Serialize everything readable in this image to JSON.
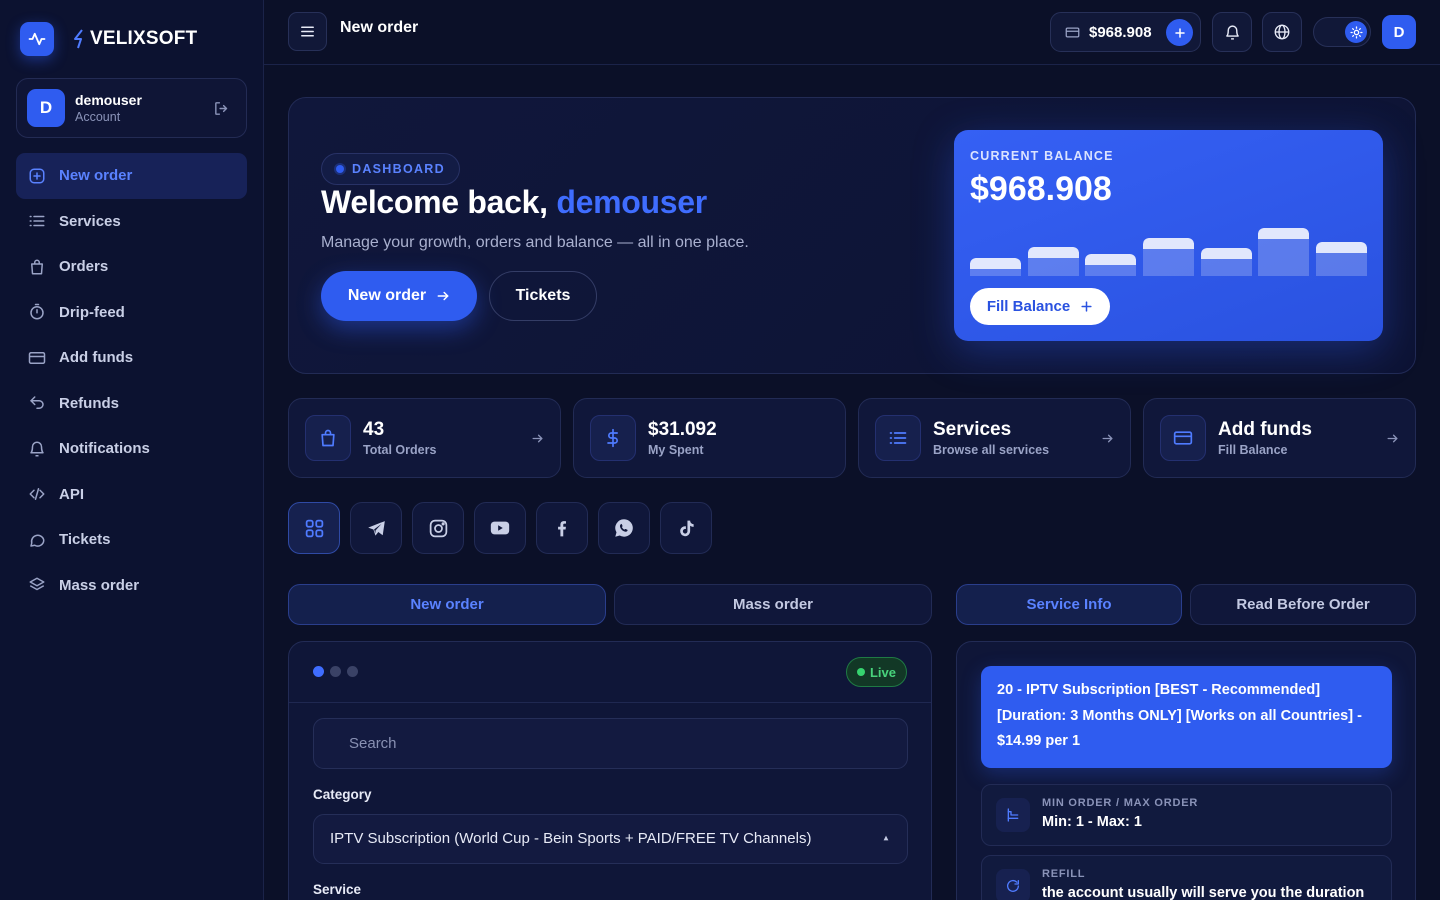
{
  "brand": {
    "name": "VELIXSOFT"
  },
  "account": {
    "initial": "D",
    "name": "demouser",
    "subtitle": "Account"
  },
  "sidebar": {
    "items": [
      {
        "label": "New order",
        "icon": "plus-square-icon",
        "active": true
      },
      {
        "label": "Services",
        "icon": "list-icon"
      },
      {
        "label": "Orders",
        "icon": "shopping-bag-icon"
      },
      {
        "label": "Drip-feed",
        "icon": "timer-icon"
      },
      {
        "label": "Add funds",
        "icon": "credit-card-icon"
      },
      {
        "label": "Refunds",
        "icon": "undo-icon"
      },
      {
        "label": "Notifications",
        "icon": "bell-icon"
      },
      {
        "label": "API",
        "icon": "code-icon"
      },
      {
        "label": "Tickets",
        "icon": "chat-icon"
      },
      {
        "label": "Mass order",
        "icon": "layers-icon"
      }
    ]
  },
  "topbar": {
    "title": "New order",
    "balance": "$968.908",
    "avatar_initial": "D"
  },
  "hero": {
    "chip": "DASHBOARD",
    "welcome_prefix": "Welcome back,",
    "welcome_name": "demouser",
    "subtitle": "Manage your growth, orders and balance — all in one place.",
    "primary_button": "New order",
    "secondary_button": "Tickets"
  },
  "balance_card": {
    "label": "CURRENT BALANCE",
    "amount": "$968.908",
    "bar_levels": [
      0.36,
      0.58,
      0.44,
      0.76,
      0.56,
      0.96,
      0.68
    ],
    "button": "Fill Balance"
  },
  "stats": [
    {
      "value": "43",
      "label": "Total Orders",
      "icon": "shopping-bag-icon",
      "arrow": true
    },
    {
      "value": "$31.092",
      "label": "My Spent",
      "icon": "dollar-icon",
      "arrow": false
    },
    {
      "value": "Services",
      "label": "Browse all services",
      "icon": "list-icon",
      "arrow": true
    },
    {
      "value": "Add funds",
      "label": "Fill Balance",
      "icon": "credit-card-icon",
      "arrow": true
    }
  ],
  "socials": [
    {
      "name": "all-categories-icon",
      "active": true
    },
    {
      "name": "telegram-icon"
    },
    {
      "name": "instagram-icon"
    },
    {
      "name": "youtube-icon"
    },
    {
      "name": "facebook-icon"
    },
    {
      "name": "whatsapp-icon"
    },
    {
      "name": "tiktok-icon"
    }
  ],
  "tabs": {
    "left": [
      {
        "label": "New order",
        "active": true
      },
      {
        "label": "Mass order"
      }
    ],
    "right": [
      {
        "label": "Service Info",
        "active": true
      },
      {
        "label": "Read Before Order"
      }
    ]
  },
  "order_form": {
    "live_label": "Live",
    "search_placeholder": "Search",
    "category_label": "Category",
    "category_value": "IPTV Subscription (World Cup - Bein Sports + PAID/FREE TV Channels)",
    "service_label": "Service"
  },
  "service_info": {
    "title": "20 - IPTV Subscription [BEST - Recommended] [Duration: 3 Months ONLY] [Works on all Countries] - $14.99 per 1",
    "items": [
      {
        "key": "MIN ORDER / MAX ORDER",
        "value": "Min: 1 - Max: 1"
      },
      {
        "key": "REFILL",
        "value": "the account usually will serve you the duration"
      }
    ]
  },
  "colors": {
    "accent": "#2f5cf0",
    "background": "#0b1028",
    "live": "#36d36f"
  }
}
